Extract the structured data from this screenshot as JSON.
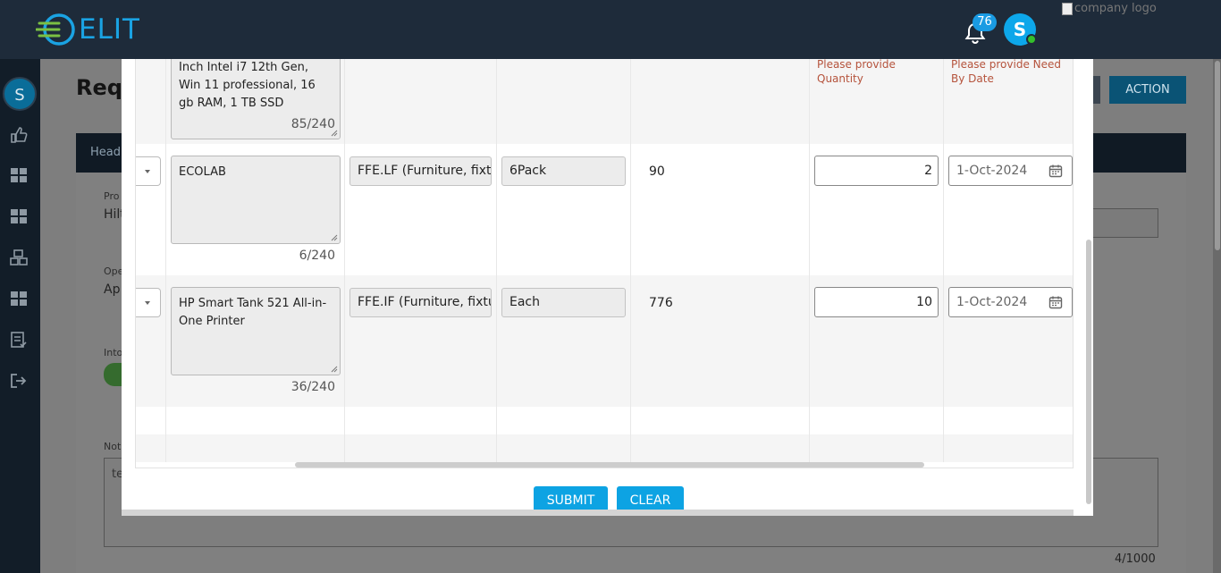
{
  "app": {
    "logo_text": "ELIT",
    "notification_count": "76",
    "user_initial": "S",
    "company_logo_alt": "company logo"
  },
  "sidebar": {
    "avatar_initial": "S",
    "icons": [
      "thumbs-up-icon",
      "grid-icon",
      "grid-icon",
      "boxes-icon",
      "grid-icon",
      "list-check-icon",
      "sign-out-icon"
    ]
  },
  "background_page": {
    "title": "Requ",
    "action_label": "ACTION",
    "card_header": "Head",
    "field1_label": "Pro",
    "field1_value": "Hilt",
    "field2_label": "Ope",
    "field2_value": "Ap",
    "field3_label": "Into",
    "notes_label": "Not",
    "notes_value": "te",
    "notes_counter": "4/1000"
  },
  "modal": {
    "rows": [
      {
        "description": "Inch Intel i7 12th Gen, Win 11 professional, 16 gb RAM, 1 TB SSD",
        "description_counter": "85/240",
        "qty_error": "Please provide Quantity",
        "date_error": "Please provide Need By Date"
      },
      {
        "description": "ECOLAB",
        "description_counter": "6/240",
        "category": "FFE.LF (Furniture, fixtures",
        "uom": "6Pack",
        "price": "90",
        "quantity": "2",
        "need_by_date": "1-Oct-2024"
      },
      {
        "description": "HP Smart Tank 521 All-in-One Printer",
        "description_counter": "36/240",
        "category": "FFE.IF (Furniture, fixtures",
        "uom": "Each",
        "price": "776",
        "quantity": "10",
        "need_by_date": "1-Oct-2024"
      }
    ],
    "submit_label": "SUBMIT",
    "clear_label": "CLEAR"
  },
  "colors": {
    "accent": "#0da3e3",
    "header_bg": "#1e2b3a",
    "error": "#b5533c",
    "online": "#34c02b"
  }
}
